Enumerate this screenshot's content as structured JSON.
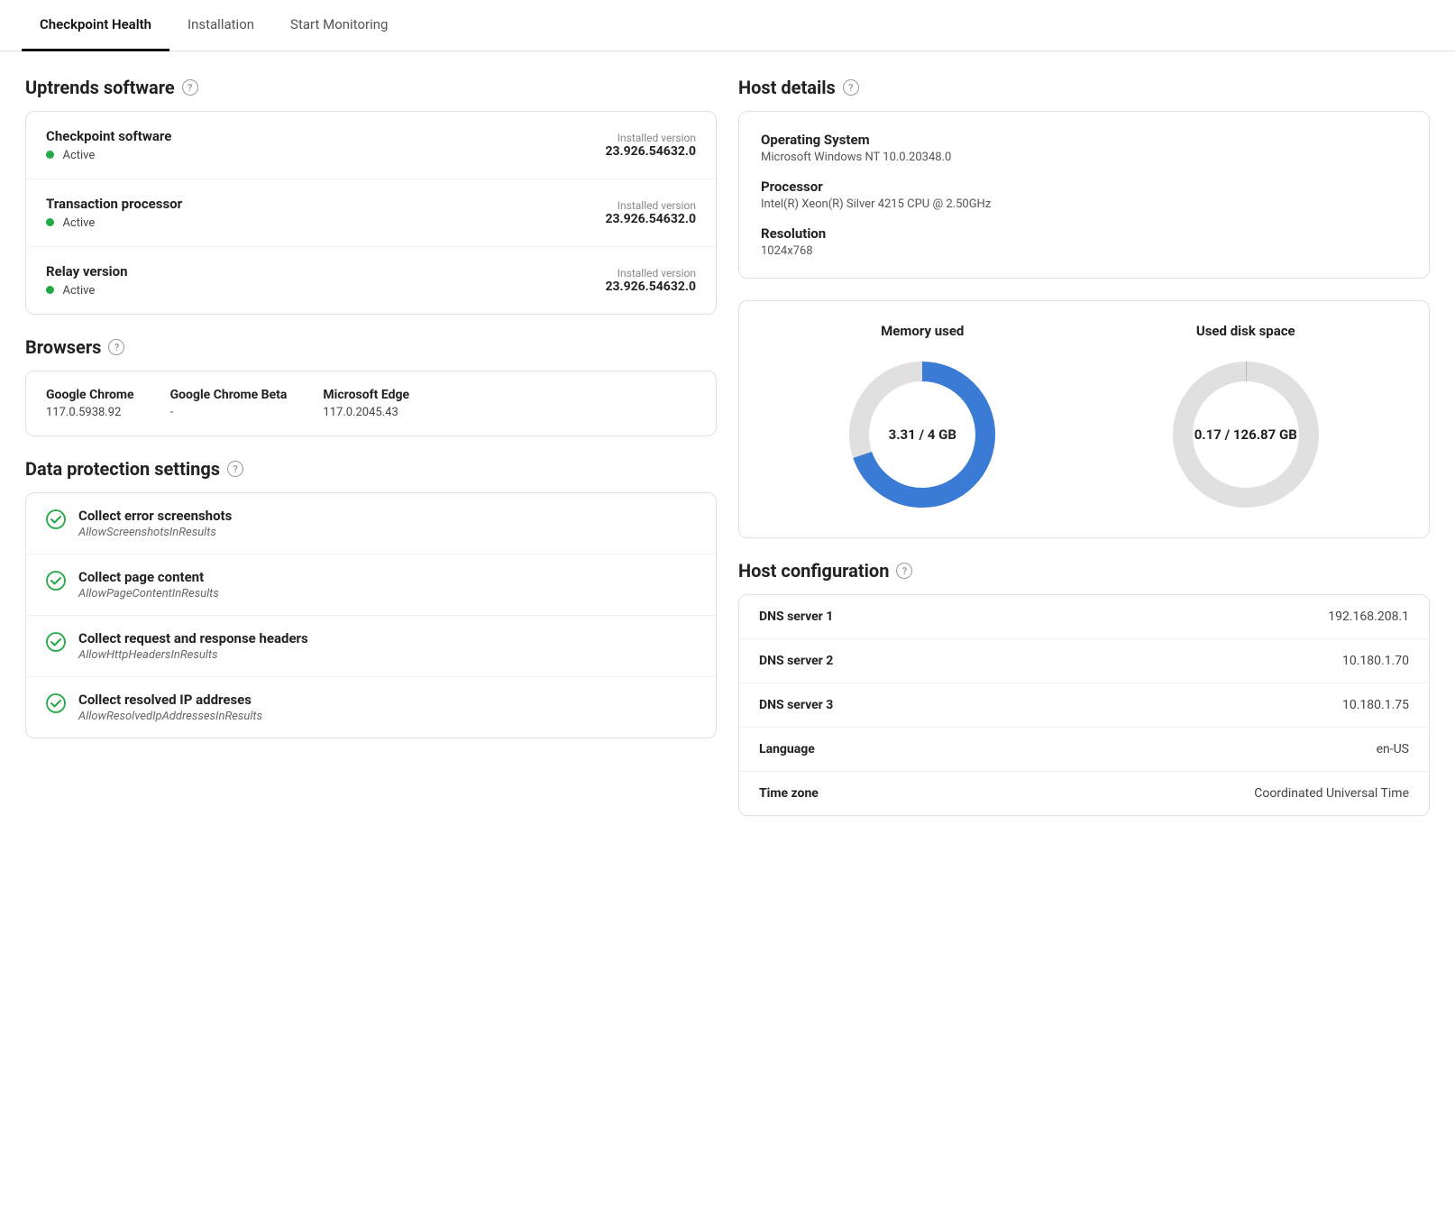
{
  "tabs": [
    {
      "id": "checkpoint-health",
      "label": "Checkpoint Health",
      "active": true
    },
    {
      "id": "installation",
      "label": "Installation",
      "active": false
    },
    {
      "id": "start-monitoring",
      "label": "Start Monitoring",
      "active": false
    }
  ],
  "uptrends_software": {
    "title": "Uptrends software",
    "items": [
      {
        "name": "Checkpoint software",
        "status": "Active",
        "version_label": "Installed version",
        "version": "23.926.54632.0"
      },
      {
        "name": "Transaction processor",
        "status": "Active",
        "version_label": "Installed version",
        "version": "23.926.54632.0"
      },
      {
        "name": "Relay version",
        "status": "Active",
        "version_label": "Installed version",
        "version": "23.926.54632.0"
      }
    ]
  },
  "browsers": {
    "title": "Browsers",
    "items": [
      {
        "name": "Google Chrome",
        "version": "117.0.5938.92"
      },
      {
        "name": "Google Chrome Beta",
        "version": "-"
      },
      {
        "name": "Microsoft Edge",
        "version": "117.0.2045.43"
      }
    ]
  },
  "data_protection": {
    "title": "Data protection settings",
    "items": [
      {
        "title": "Collect error screenshots",
        "sub": "AllowScreenshotsInResults"
      },
      {
        "title": "Collect page content",
        "sub": "AllowPageContentInResults"
      },
      {
        "title": "Collect request and response headers",
        "sub": "AllowHttpHeadersInResults"
      },
      {
        "title": "Collect resolved IP addreses",
        "sub": "AllowResolvedIpAddressesInResults"
      }
    ]
  },
  "host_details": {
    "title": "Host details",
    "items": [
      {
        "label": "Operating System",
        "value": "Microsoft Windows NT 10.0.20348.0"
      },
      {
        "label": "Processor",
        "value": "Intel(R) Xeon(R) Silver 4215 CPU @ 2.50GHz"
      },
      {
        "label": "Resolution",
        "value": "1024x768"
      }
    ]
  },
  "memory": {
    "title": "Memory used",
    "used": 3.31,
    "total": 4,
    "label": "3.31 / 4 GB",
    "percent": 82.75,
    "color": "#3a7bd5"
  },
  "disk": {
    "title": "Used disk space",
    "used": 0.17,
    "total": 126.87,
    "label": "0.17 / 126.87 GB",
    "percent": 0.134,
    "color": "#d0d0d0"
  },
  "host_configuration": {
    "title": "Host configuration",
    "items": [
      {
        "key": "DNS server 1",
        "value": "192.168.208.1"
      },
      {
        "key": "DNS server 2",
        "value": "10.180.1.70"
      },
      {
        "key": "DNS server 3",
        "value": "10.180.1.75"
      },
      {
        "key": "Language",
        "value": "en-US"
      },
      {
        "key": "Time zone",
        "value": "Coordinated Universal Time"
      }
    ]
  }
}
